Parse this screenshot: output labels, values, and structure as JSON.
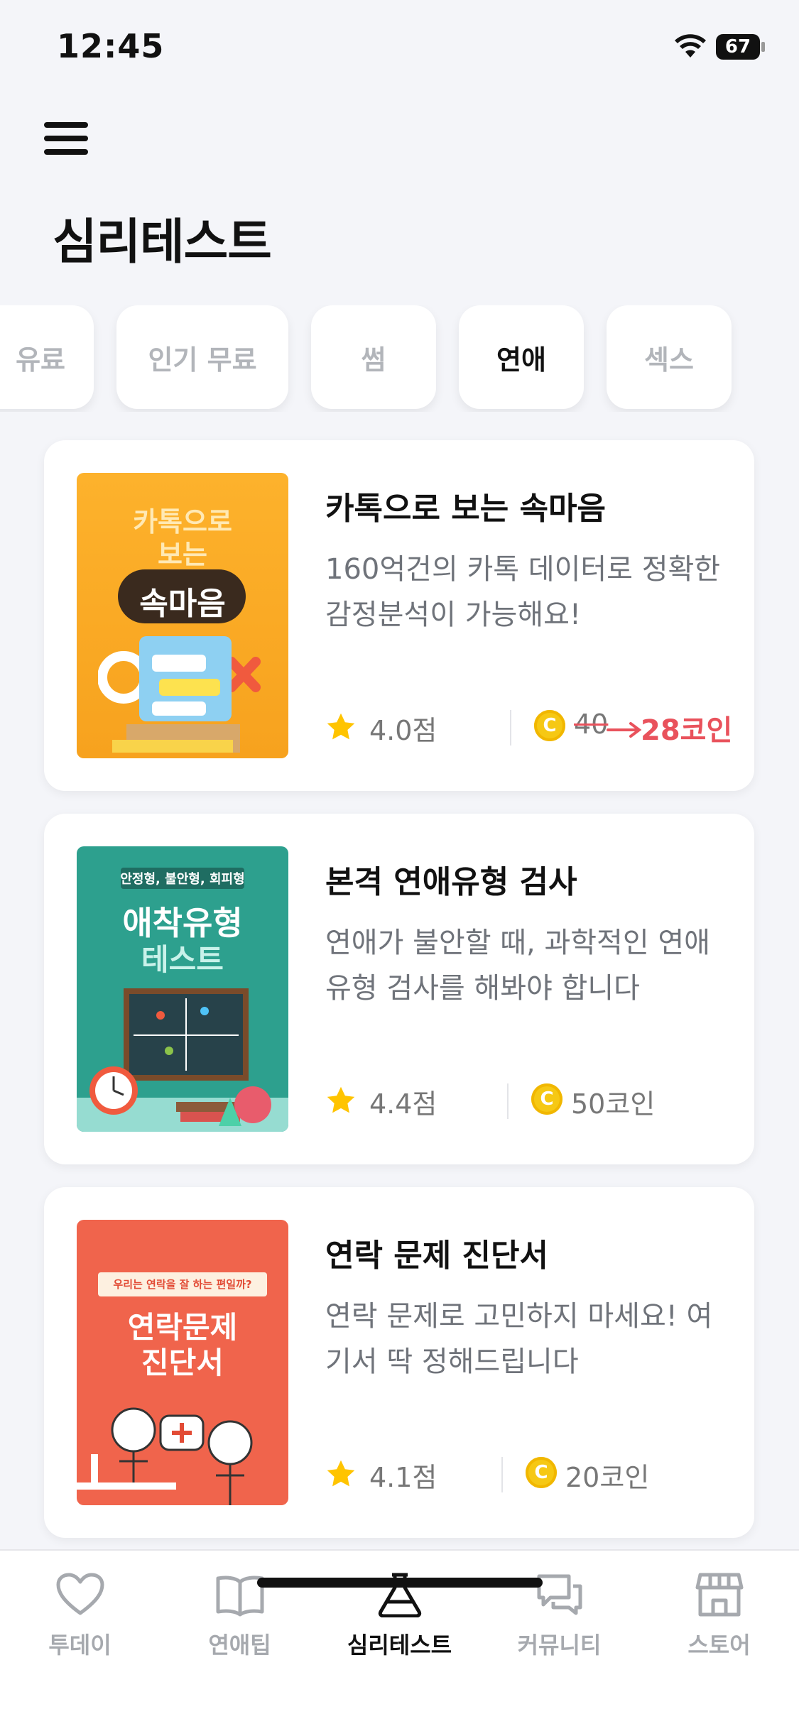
{
  "status_bar": {
    "time": "12:45",
    "battery": "67"
  },
  "page": {
    "title": "심리테스트"
  },
  "chips": [
    {
      "label": "유료",
      "active": false
    },
    {
      "label": "인기 무료",
      "active": false
    },
    {
      "label": "썸",
      "active": false
    },
    {
      "label": "연애",
      "active": true
    },
    {
      "label": "섹스",
      "active": false
    }
  ],
  "tests": [
    {
      "title": "카톡으로 보는 속마음",
      "description": "160억건의 카톡 데이터로 정확한 감정분석이 가능해요!",
      "rating": "4.0점",
      "coin_symbol": "C",
      "original_price": "40",
      "price": "28코인",
      "thumb_lines": [
        "카톡으로",
        "보는",
        "속마음"
      ]
    },
    {
      "title": "본격 연애유형 검사",
      "description": "연애가 불안할 때, 과학적인 연애 유형 검사를 해봐야 합니다",
      "rating": "4.4점",
      "coin_symbol": "C",
      "price": "50코인",
      "thumb_lines": [
        "안정형, 불안형, 회피형",
        "애착유형",
        "테스트"
      ]
    },
    {
      "title": "연락 문제 진단서",
      "description": "연락 문제로 고민하지 마세요! 여기서 딱 정해드립니다",
      "rating": "4.1점",
      "coin_symbol": "C",
      "price": "20코인",
      "thumb_lines": [
        "우리는 연락을 잘 하는 편일까?",
        "연락문제",
        "진단서"
      ]
    }
  ],
  "tabbar": [
    {
      "label": "투데이",
      "icon": "heart-icon",
      "active": false
    },
    {
      "label": "연애팁",
      "icon": "book-icon",
      "active": false
    },
    {
      "label": "심리테스트",
      "icon": "flask-icon",
      "active": true
    },
    {
      "label": "커뮤니티",
      "icon": "chat-icon",
      "active": false
    },
    {
      "label": "스토어",
      "icon": "store-icon",
      "active": false
    }
  ],
  "colors": {
    "accent": "#E9525C",
    "coin": "#F6C814",
    "star": "#FFC400",
    "background": "#F4F5F9"
  }
}
